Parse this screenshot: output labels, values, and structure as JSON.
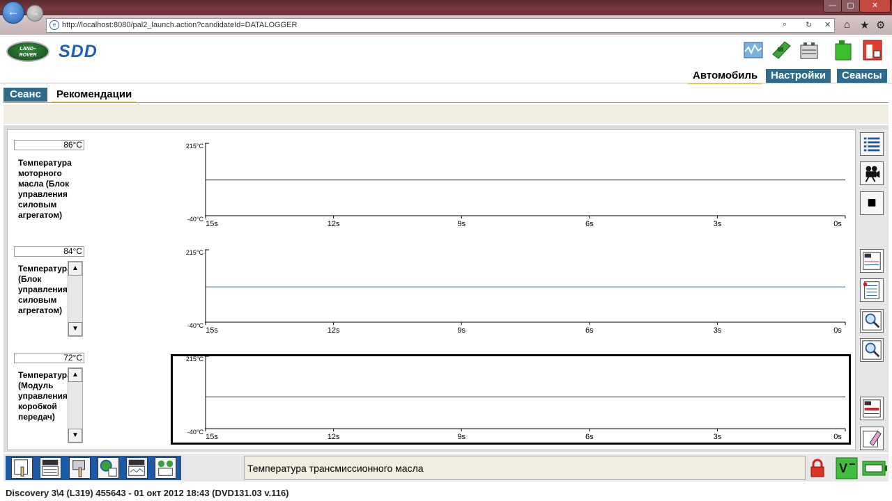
{
  "browser": {
    "url": "http://localhost:8080/pal2_launch.action?candidateId=DATALOGGER"
  },
  "app": {
    "logo_text_line1": "LAND",
    "logo_text_line2": "ROVER",
    "product": "SDD",
    "nav": {
      "vehicle": "Автомобиль",
      "settings": "Настройки",
      "sessions": "Сеансы"
    },
    "tabs": {
      "session": "Сеанс",
      "recommendations": "Рекомендации"
    }
  },
  "parameters": [
    {
      "value": "86°C",
      "label": "Температура\nмоторного\nмасла (Блок\nуправления\nсиловым\nагрегатом)",
      "y_max": "215°C",
      "y_min": "-40°C",
      "trace_level": 0.5,
      "selected": false
    },
    {
      "value": "84°C",
      "label": "Температура\n(Блок\nуправления\nсиловым\nагрегатом)",
      "y_max": "215°C",
      "y_min": "-40°C",
      "trace_level": 0.5,
      "selected": false
    },
    {
      "value": "72°C",
      "label": "Температура\n(Модуль\nуправления\nкоробкой\nпередач)",
      "y_max": "215°C",
      "y_min": "-40°C",
      "trace_level": 0.47,
      "selected": true
    }
  ],
  "x_ticks": [
    "15s",
    "12s",
    "9s",
    "6s",
    "3s",
    "0s"
  ],
  "chart_data": [
    {
      "type": "line",
      "series": [
        {
          "x": [
            15,
            12,
            9,
            6,
            3,
            0
          ],
          "values": [
            86,
            86,
            86,
            86,
            86,
            86
          ]
        }
      ],
      "xlabel": "",
      "ylabel": "",
      "ylim": [
        -40,
        215
      ],
      "xlim": [
        15,
        0
      ],
      "x_tick_labels": [
        "15s",
        "12s",
        "9s",
        "6s",
        "3s",
        "0s"
      ]
    },
    {
      "type": "line",
      "series": [
        {
          "x": [
            15,
            12,
            9,
            6,
            3,
            0
          ],
          "values": [
            84,
            84,
            84,
            84,
            84,
            84
          ]
        }
      ],
      "xlabel": "",
      "ylabel": "",
      "ylim": [
        -40,
        215
      ],
      "xlim": [
        15,
        0
      ],
      "x_tick_labels": [
        "15s",
        "12s",
        "9s",
        "6s",
        "3s",
        "0s"
      ]
    },
    {
      "type": "line",
      "series": [
        {
          "x": [
            15,
            12,
            9,
            6,
            3,
            0
          ],
          "values": [
            72,
            72,
            72,
            72,
            72,
            72
          ]
        }
      ],
      "xlabel": "",
      "ylabel": "",
      "ylim": [
        -40,
        215
      ],
      "xlim": [
        15,
        0
      ],
      "x_tick_labels": [
        "15s",
        "12s",
        "9s",
        "6s",
        "3s",
        "0s"
      ]
    }
  ],
  "bottom": {
    "status": "Температура трансмиссионного масла",
    "footer": "Discovery 3\\4 (L319) 455643 - 01 окт 2012 18:43 (DVD131.03 v.116)"
  },
  "icons": {
    "close": "✕",
    "maximize": "▢",
    "minimize": "—",
    "back": "←",
    "forward": "→",
    "home": "⌂",
    "star": "★",
    "gear": "⚙",
    "search": "⌕",
    "refresh": "↻",
    "stop": "✕",
    "scroll_up": "▲",
    "scroll_down": "▼",
    "side_stop": "■"
  },
  "colors": {
    "accent": "#2f6b8c",
    "tab_underline": "#e6c25c",
    "bottom_left": "#1c5aa8"
  }
}
